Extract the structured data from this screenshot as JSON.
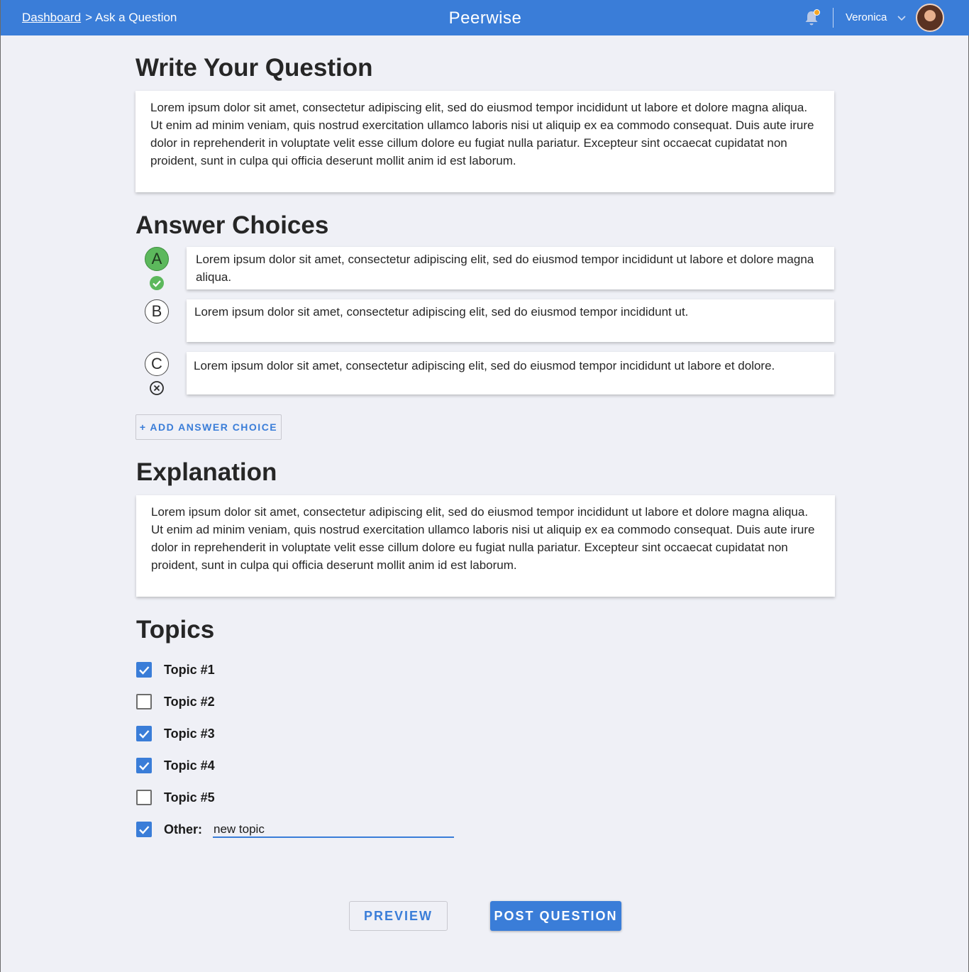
{
  "header": {
    "breadcrumb_link": "Dashboard",
    "breadcrumb_sep": ">",
    "breadcrumb_current": "Ask a Question",
    "app_title": "Peerwise",
    "user_name": "Veronica",
    "icons": [
      "bell-icon",
      "chevron-down-icon",
      "avatar"
    ],
    "accent_color": "#3a7dd8",
    "notification_color": "#f6a623"
  },
  "question": {
    "heading": "Write Your Question",
    "text": "Lorem ipsum dolor sit amet, consectetur adipiscing elit, sed do eiusmod tempor incididunt ut labore et dolore magna aliqua. Ut enim ad minim veniam, quis nostrud exercitation ullamco laboris nisi ut aliquip ex ea commodo consequat. Duis aute irure dolor in reprehenderit in voluptate velit esse cillum dolore eu fugiat nulla pariatur. Excepteur sint occaecat cupidatat non proident, sunt in culpa qui officia deserunt mollit anim id est laborum."
  },
  "answers": {
    "heading": "Answer Choices",
    "choices": [
      {
        "letter": "A",
        "text": "Lorem ipsum dolor sit amet, consectetur adipiscing elit, sed do eiusmod tempor incididunt ut labore et dolore magna aliqua.",
        "correct": true,
        "icon": "check-circle-icon"
      },
      {
        "letter": "B",
        "text": "Lorem ipsum dolor sit amet, consectetur adipiscing elit, sed do eiusmod tempor incididunt ut.",
        "correct": false
      },
      {
        "letter": "C",
        "text": "Lorem ipsum dolor sit amet, consectetur adipiscing elit, sed do eiusmod tempor incididunt ut labore et dolore.",
        "correct": false,
        "icon": "remove-circle-icon"
      }
    ],
    "add_label": "+ ADD ANSWER CHOICE",
    "correct_color": "#5cb85c"
  },
  "explanation": {
    "heading": "Explanation",
    "text": "Lorem ipsum dolor sit amet, consectetur adipiscing elit, sed do eiusmod tempor incididunt ut labore et dolore magna aliqua. Ut enim ad minim veniam, quis nostrud exercitation ullamco laboris nisi ut aliquip ex ea commodo consequat. Duis aute irure dolor in reprehenderit in voluptate velit esse cillum dolore eu fugiat nulla pariatur. Excepteur sint occaecat cupidatat non proident, sunt in culpa qui officia deserunt mollit anim id est laborum."
  },
  "topics": {
    "heading": "Topics",
    "items": [
      {
        "label": "Topic #1",
        "checked": true
      },
      {
        "label": "Topic #2",
        "checked": false
      },
      {
        "label": "Topic #3",
        "checked": true
      },
      {
        "label": "Topic #4",
        "checked": true
      },
      {
        "label": "Topic #5",
        "checked": false
      }
    ],
    "other": {
      "label": "Other:",
      "checked": true,
      "value": "new topic"
    }
  },
  "actions": {
    "preview_label": "PREVIEW",
    "post_label": "POST QUESTION"
  }
}
